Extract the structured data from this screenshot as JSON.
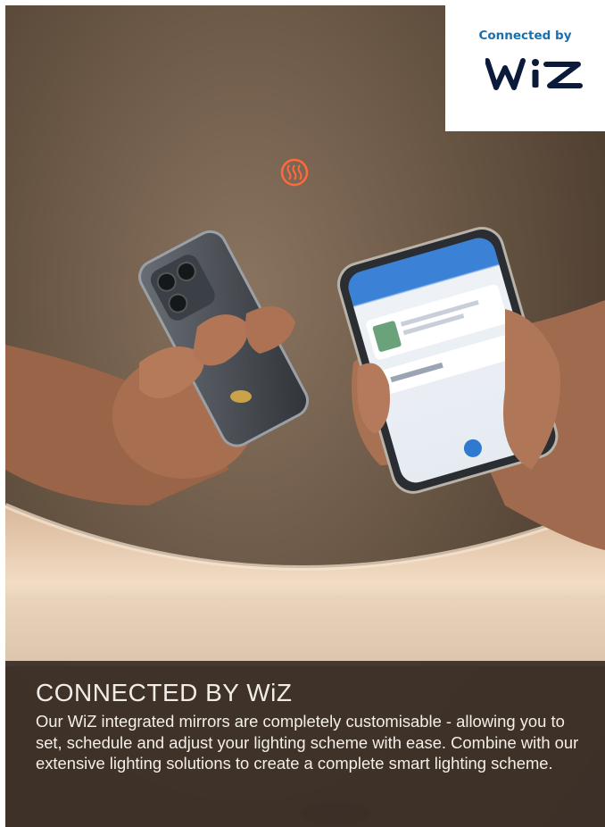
{
  "badge": {
    "label": "Connected by",
    "logo_text": "WiZ",
    "label_color": "#1a6fb0",
    "logo_color": "#0b1a3a"
  },
  "panel": {
    "heading": "CONNECTED BY WiZ",
    "body": "Our WiZ integrated mirrors are completely customisable - allowing you to set, schedule and adjust your lighting scheme with ease. Combine with our extensive lighting solutions to create a complete smart lighting scheme."
  },
  "icons": [
    "heat-icon"
  ]
}
